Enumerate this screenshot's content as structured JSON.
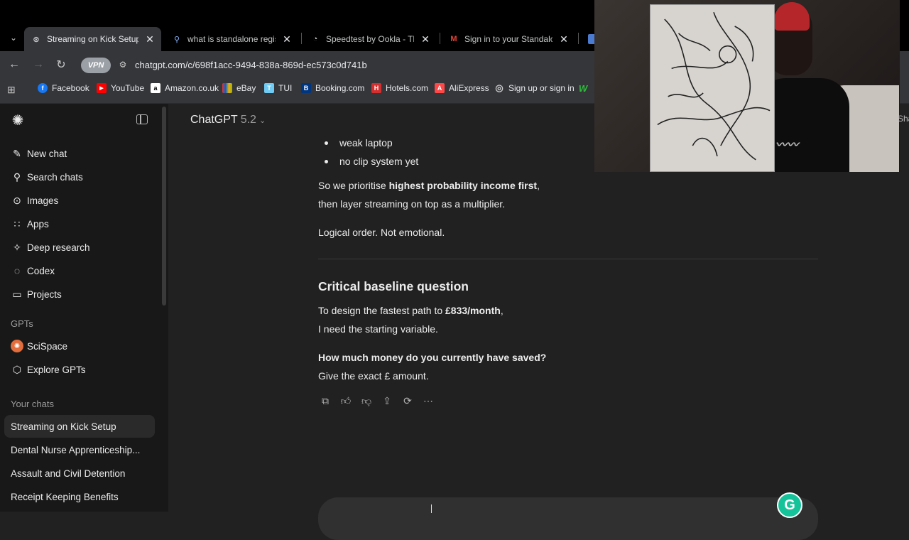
{
  "browser": {
    "tabs": [
      {
        "title": "Streaming on Kick Setup",
        "icon": "chatgpt-icon",
        "active": true
      },
      {
        "title": "what is standalone registration",
        "icon": "search-icon",
        "active": false
      },
      {
        "title": "Speedtest by Ookla - The Global",
        "icon": "speedtest-icon",
        "active": false
      },
      {
        "title": "Sign in to your Standalone",
        "icon": "gmail-icon",
        "active": false
      }
    ],
    "vpn_label": "VPN",
    "url": "chatgpt.com/c/698f1acc-9494-838a-869d-ec573c0d741b",
    "bookmarks": [
      {
        "label": "Facebook",
        "color": "#1877f2",
        "glyph": "f"
      },
      {
        "label": "YouTube",
        "color": "#ff0000",
        "glyph": "▶"
      },
      {
        "label": "Amazon.co.uk",
        "color": "#ffffff",
        "glyph": "a"
      },
      {
        "label": "eBay",
        "color": "#e53238",
        "glyph": "e"
      },
      {
        "label": "TUI",
        "color": "#70cbf4",
        "glyph": "T"
      },
      {
        "label": "Booking.com",
        "color": "#003580",
        "glyph": "B"
      },
      {
        "label": "Hotels.com",
        "color": "#d32f2f",
        "glyph": "H"
      },
      {
        "label": "AliExpress",
        "color": "#ff4747",
        "glyph": "A"
      },
      {
        "label": "Sign up or sign in",
        "color": "#cccccc",
        "glyph": "◎"
      },
      {
        "label": "",
        "color": "#2dbe3c",
        "glyph": "W"
      }
    ]
  },
  "sidebar": {
    "items": [
      {
        "label": "New chat",
        "icon": "new-chat-icon"
      },
      {
        "label": "Search chats",
        "icon": "search-icon"
      },
      {
        "label": "Images",
        "icon": "images-icon"
      },
      {
        "label": "Apps",
        "icon": "apps-icon"
      },
      {
        "label": "Deep research",
        "icon": "deep-research-icon"
      },
      {
        "label": "Codex",
        "icon": "codex-icon"
      },
      {
        "label": "Projects",
        "icon": "projects-icon"
      }
    ],
    "gpts_heading": "GPTs",
    "gpts": [
      {
        "label": "SciSpace",
        "icon": "scispace-icon"
      },
      {
        "label": "Explore GPTs",
        "icon": "explore-icon"
      }
    ],
    "chats_heading": "Your chats",
    "chats": [
      "Streaming on Kick Setup",
      "Dental Nurse Apprenticeship...",
      "Assault and Civil Detention",
      "Receipt Keeping Benefits"
    ]
  },
  "main": {
    "model_name": "ChatGPT",
    "model_version": "5.2",
    "bullets": [
      "weak laptop",
      "no clip system yet"
    ],
    "para1_pre": "So we prioritise ",
    "para1_bold": "highest probability income first",
    "para1_post": ",",
    "para1_line2": "then layer streaming on top as a multiplier.",
    "para2": "Logical order. Not emotional.",
    "heading": "Critical baseline question",
    "para3_pre": "To design the fastest path to ",
    "para3_bold": "£833/month",
    "para3_post": ",",
    "para3_line2": "I need the starting variable.",
    "question_bold": "How much money do you currently have saved?",
    "question_line2": "Give the exact £ amount."
  },
  "overlay": {
    "right_edge_text": "Sha"
  },
  "colors": {
    "background": "#212121",
    "sidebar": "#181818",
    "chrome": "#35363a",
    "grammarly": "#15c39a"
  }
}
